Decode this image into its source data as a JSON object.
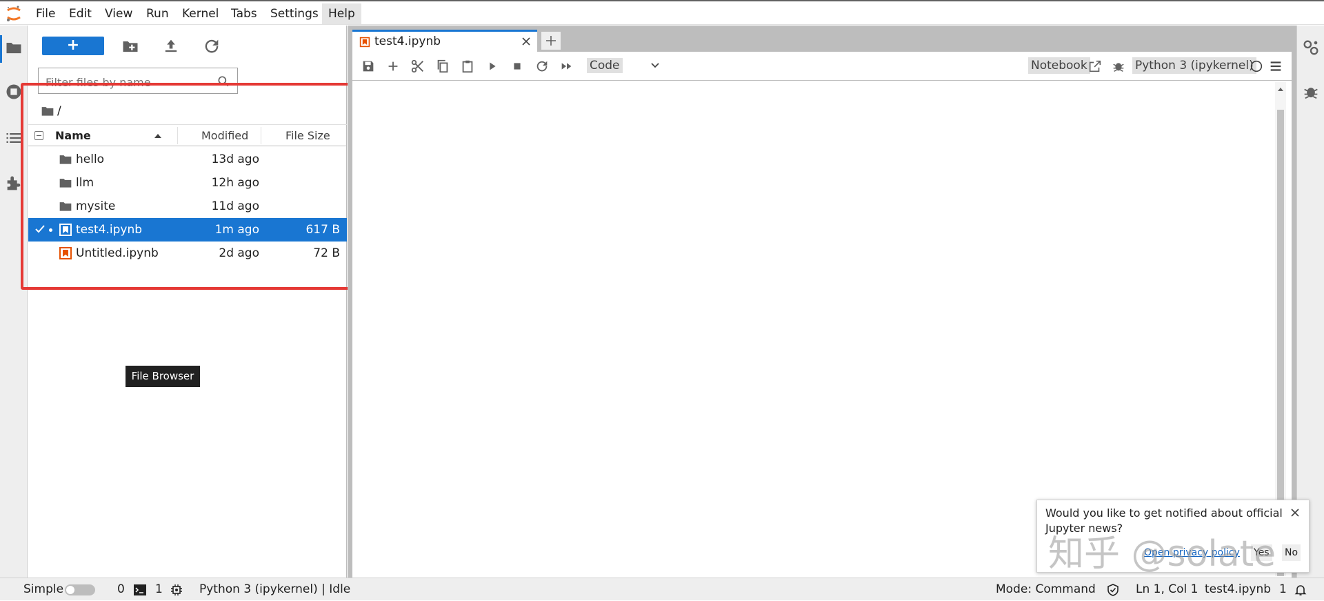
{
  "menubar": {
    "items": [
      "File",
      "Edit",
      "View",
      "Run",
      "Kernel",
      "Tabs",
      "Settings",
      "Help"
    ],
    "active": "Help"
  },
  "filebrowser": {
    "new_label": "+",
    "filter_placeholder": "Filter files by name",
    "breadcrumb_root": "/",
    "columns": {
      "name": "Name",
      "modified": "Modified",
      "size": "File Size"
    },
    "files": [
      {
        "name": "hello",
        "type": "folder",
        "modified": "13d ago",
        "size": ""
      },
      {
        "name": "llm",
        "type": "folder",
        "modified": "12h ago",
        "size": ""
      },
      {
        "name": "mysite",
        "type": "folder",
        "modified": "11d ago",
        "size": ""
      },
      {
        "name": "test4.ipynb",
        "type": "notebook",
        "modified": "1m ago",
        "size": "617 B",
        "selected": true,
        "running": true
      },
      {
        "name": "Untitled.ipynb",
        "type": "notebook",
        "modified": "2d ago",
        "size": "72 B"
      }
    ],
    "tooltip": "File Browser"
  },
  "tabs": {
    "active_tab": "test4.ipynb"
  },
  "notebook_toolbar": {
    "cell_type": "Code",
    "notebook_label": "Notebook",
    "kernel_name": "Python 3 (ipykernel)"
  },
  "notification": {
    "message": "Would you like to get notified about official Jupyter news?",
    "privacy_link": "Open privacy policy",
    "yes_label": "Yes",
    "no_label": "No"
  },
  "watermark": "知乎 @solate",
  "statusbar": {
    "simple_label": "Simple",
    "terminals_count": "0",
    "kernels_count": "1",
    "kernel_status": "Python 3 (ipykernel) | Idle",
    "mode": "Mode: Command",
    "cursor": "Ln 1, Col 1",
    "file": "test4.ipynb",
    "notifications_count": "1"
  },
  "colors": {
    "accent": "#1976d2",
    "highlight_box": "#e53935",
    "notebook_icon": "#e65100"
  },
  "icons": {
    "logo": "jupyter-logo",
    "sidebar": [
      "folder-icon",
      "running-icon",
      "toc-icon",
      "extension-icon"
    ],
    "rightbar": [
      "property-inspector-icon",
      "debugger-icon"
    ],
    "toolbar": [
      "save-icon",
      "insert-cell-icon",
      "cut-icon",
      "copy-icon",
      "paste-icon",
      "run-icon",
      "stop-icon",
      "restart-icon",
      "fast-forward-icon"
    ]
  }
}
